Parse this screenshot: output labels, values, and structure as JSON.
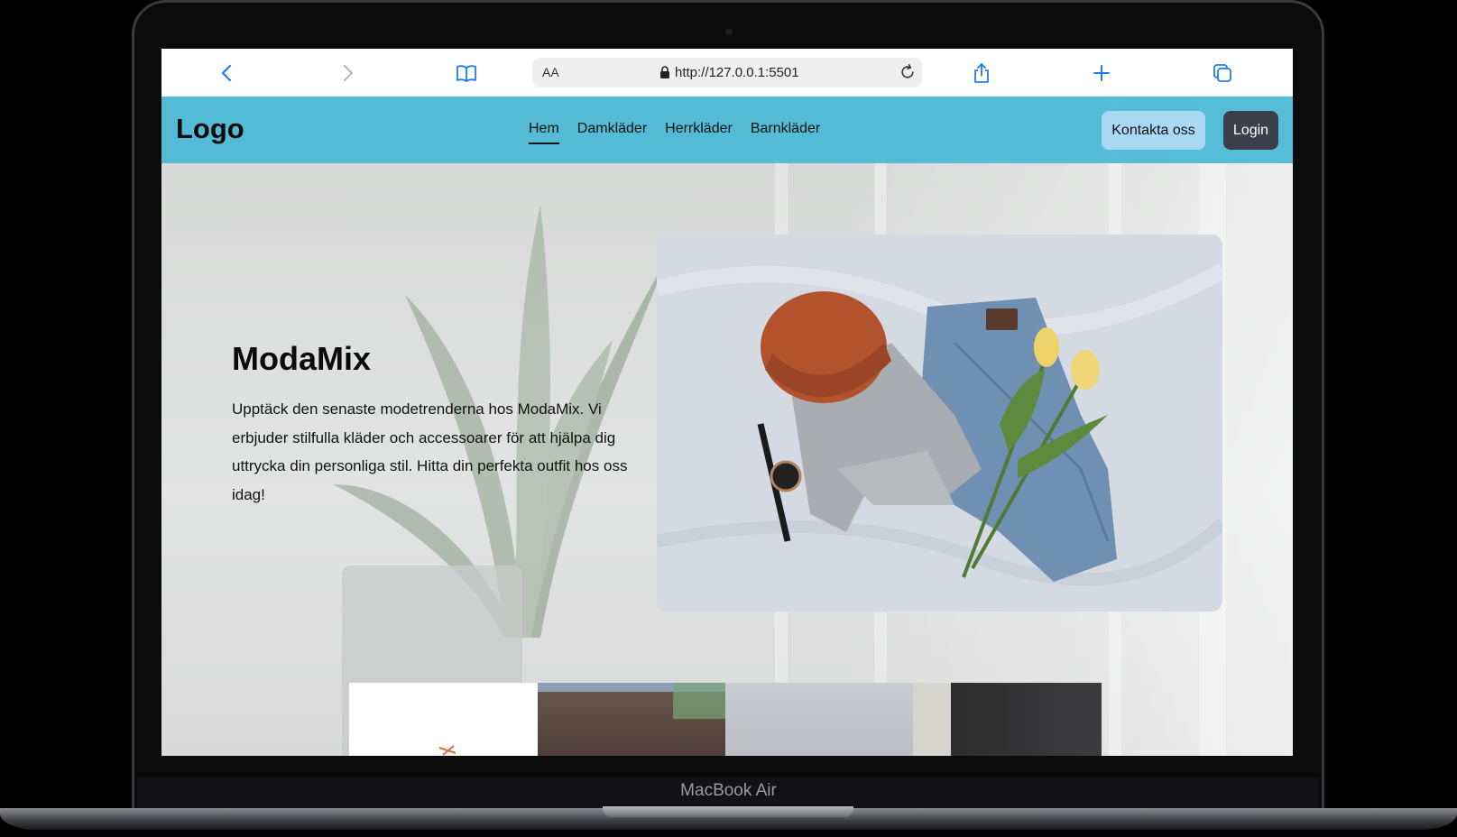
{
  "device": {
    "label": "MacBook Air"
  },
  "browser": {
    "text_size_label": "AA",
    "url": "http://127.0.0.1:5501"
  },
  "header": {
    "logo": "Logo",
    "nav": [
      {
        "label": "Hem",
        "active": true
      },
      {
        "label": "Damkläder",
        "active": false
      },
      {
        "label": "Herrkläder",
        "active": false
      },
      {
        "label": "Barnkläder",
        "active": false
      }
    ],
    "contact_button": "Kontakta oss",
    "login_button": "Login",
    "color": "#48b8d6"
  },
  "hero": {
    "title": "ModaMix",
    "text": "Upptäck den senaste modetrenderna hos ModaMix. Vi erbjuder stilfulla kläder och accessoarer för att hjälpa dig uttrycka din personliga stil. Hitta din perfekta outfit hos oss idag!"
  }
}
